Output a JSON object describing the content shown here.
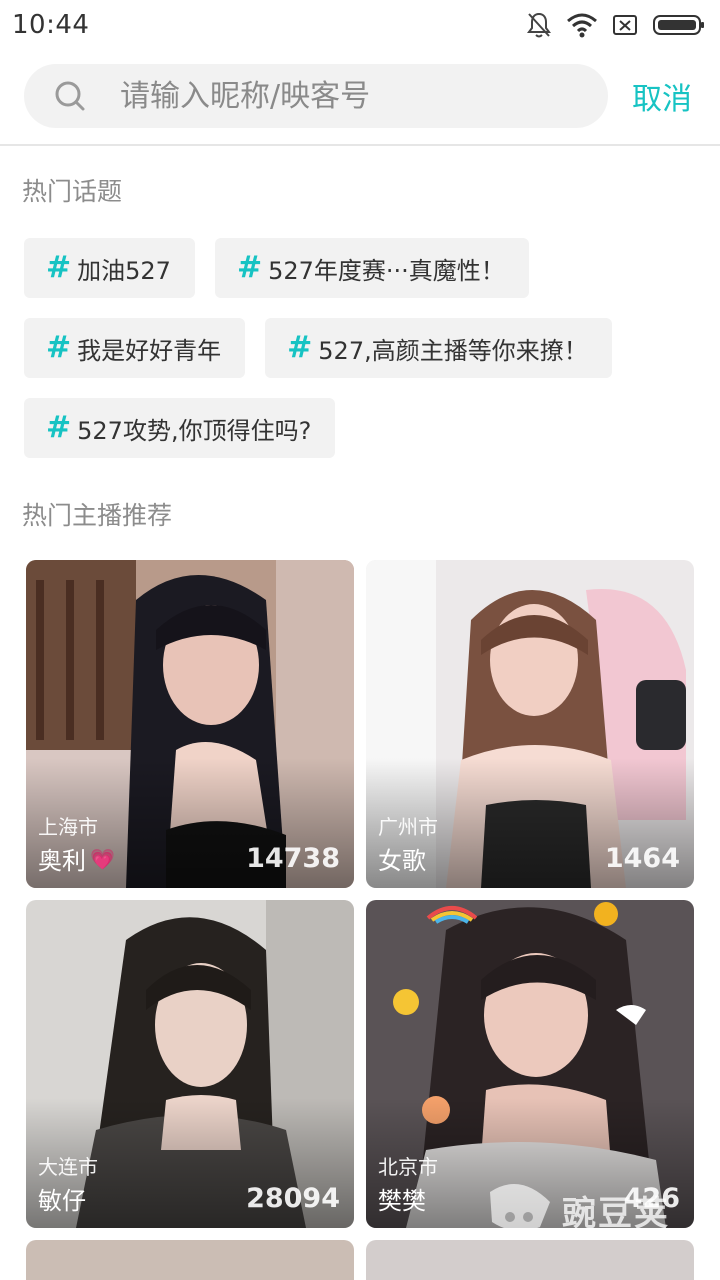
{
  "status_bar": {
    "time": "10:44",
    "icons": [
      "bell-off-icon",
      "wifi-icon",
      "sim-off-icon",
      "battery-icon"
    ]
  },
  "search": {
    "placeholder": "请输入昵称/映客号",
    "value": "",
    "cancel_label": "取消",
    "accent_color": "#17c3c3"
  },
  "hot_topics": {
    "title": "热门话题",
    "hash": "#",
    "items": [
      {
        "label": "加油527"
      },
      {
        "label": "527年度赛···真魔性！"
      },
      {
        "label": "我是好好青年"
      },
      {
        "label": "527,高颜主播等你来撩！"
      },
      {
        "label": "527攻势,你顶得住吗?"
      }
    ]
  },
  "hot_anchors": {
    "title": "热门主播推荐",
    "items": [
      {
        "city": "上海市",
        "name": "奥利",
        "heart": "💗",
        "count": "14738"
      },
      {
        "city": "广州市",
        "name": "女歌",
        "heart": "",
        "count": "1464"
      },
      {
        "city": "大连市",
        "name": "敏仔",
        "heart": "",
        "count": "28094"
      },
      {
        "city": "北京市",
        "name": "樊樊",
        "heart": "",
        "count": "426"
      }
    ]
  },
  "watermark": {
    "text": "豌豆荚"
  }
}
